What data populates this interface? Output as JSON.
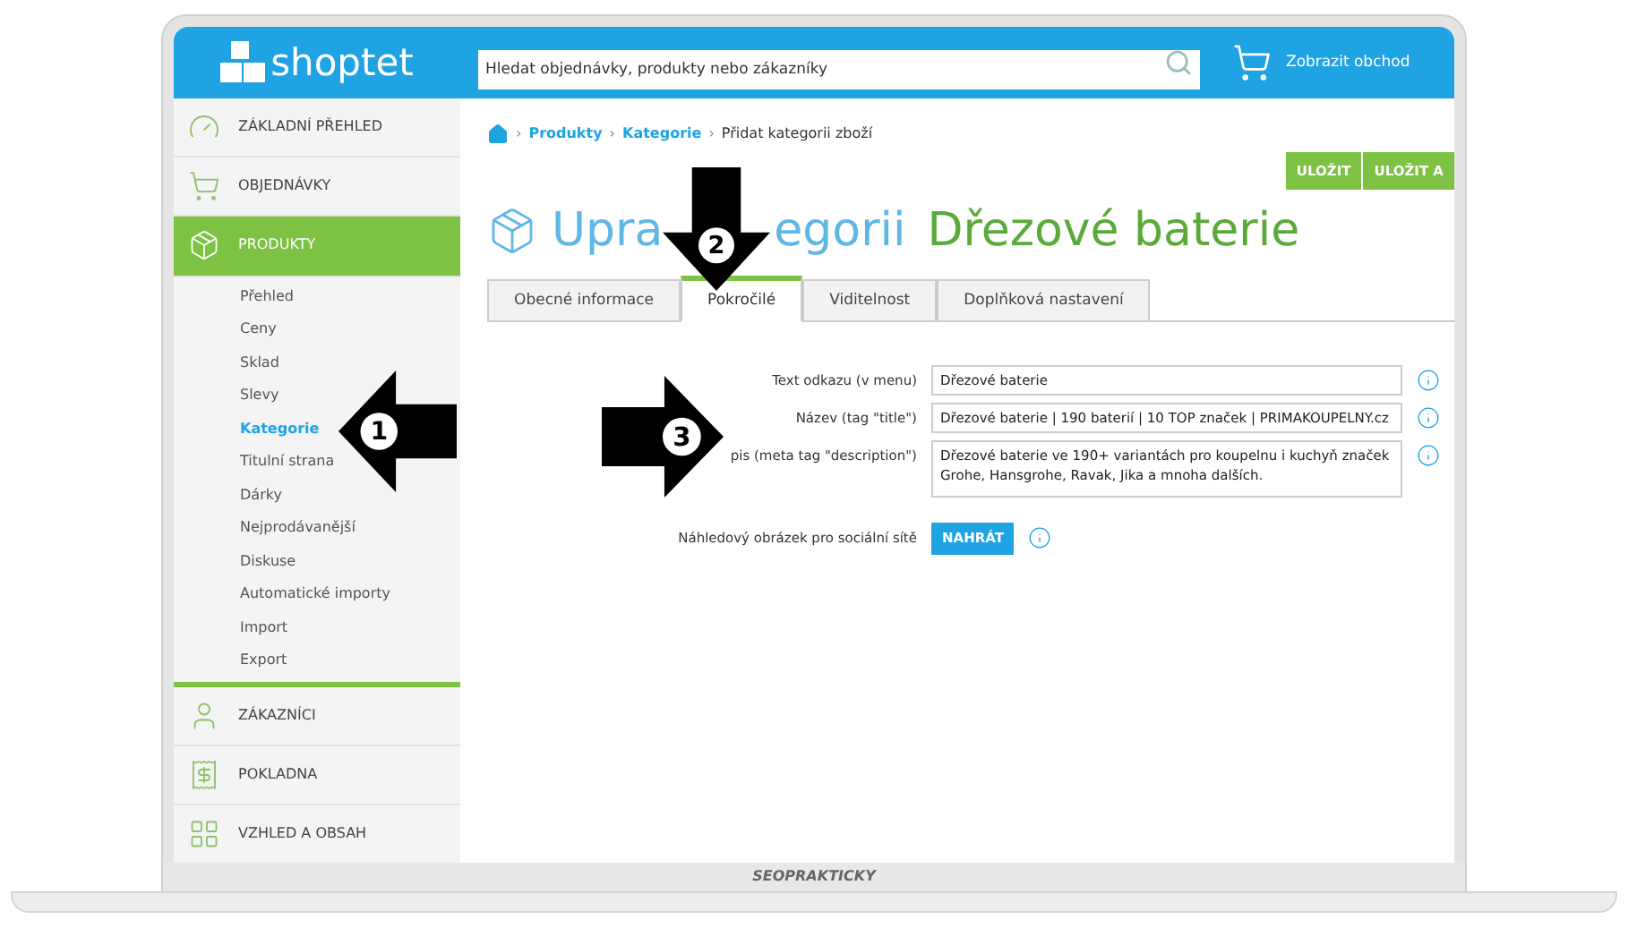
{
  "header": {
    "logo": "shoptet",
    "search": {
      "placeholder": "Hledat objednávky, produkty nebo zákazníky"
    },
    "view_shop": "Zobrazit obchod"
  },
  "sidebar": {
    "items": [
      {
        "label": "ZÁKLADNÍ PŘEHLED",
        "selected": false
      },
      {
        "label": "OBJEDNÁVKY",
        "selected": false
      },
      {
        "label": "PRODUKTY",
        "selected": true,
        "children": [
          {
            "label": "Přehled",
            "selected": false
          },
          {
            "label": "Ceny",
            "selected": false
          },
          {
            "label": "Sklad",
            "selected": false
          },
          {
            "label": "Slevy",
            "selected": false
          },
          {
            "label": "Kategorie",
            "selected": true
          },
          {
            "label": "Titulní strana",
            "selected": false
          },
          {
            "label": "Dárky",
            "selected": false
          },
          {
            "label": "Nejprodávanější",
            "selected": false
          },
          {
            "label": "Diskuse",
            "selected": false
          },
          {
            "label": "Automatické importy",
            "selected": false
          },
          {
            "label": "Import",
            "selected": false
          },
          {
            "label": "Export",
            "selected": false
          }
        ]
      },
      {
        "label": "ZÁKAZNÍCI",
        "selected": false
      },
      {
        "label": "POKLADNA",
        "selected": false
      },
      {
        "label": "VZHLED A OBSAH",
        "selected": false
      }
    ]
  },
  "breadcrumb": [
    {
      "separator": "›",
      "label": "Produkty",
      "link": true
    },
    {
      "separator": "›",
      "label": "Kategorie",
      "link": true
    },
    {
      "separator": "›",
      "label": "Přidat kategorii zboží",
      "link": false
    }
  ],
  "actions": [
    "ULOŽIT",
    "ULOŽIT A"
  ],
  "title": {
    "visible_parts": [
      "Upra",
      "egorii"
    ],
    "name": "Dřezové baterie"
  },
  "tabs": [
    {
      "label": "Obecné informace",
      "selected": false
    },
    {
      "label": "Pokročilé",
      "selected": true
    },
    {
      "label": "Viditelnost",
      "selected": false
    },
    {
      "label": "Doplňková nastavení",
      "selected": false
    }
  ],
  "form": [
    {
      "kind": "input",
      "label": "Text odkazu (v menu)",
      "value": "Dřezové baterie"
    },
    {
      "kind": "input",
      "label": "Název (tag \"title\")",
      "value": "Dřezové baterie | 190 baterií | 10 TOP značek | PRIMAKOUPELNY.cz"
    },
    {
      "kind": "textarea",
      "label": "pis (meta tag \"description\")",
      "value": "Dřezové baterie ve 190+ variantách pro koupelnu i kuchyň značek Grohe, Hansgrohe, Ravak, Jika a mnoha dalších."
    },
    {
      "kind": "upload",
      "label": "Náhledový obrázek pro sociální sítě",
      "value": "NAHRÁT"
    }
  ],
  "annotations": [
    "1",
    "2",
    "3"
  ],
  "footer": {
    "brand": "SEOPRAKTICKY"
  }
}
